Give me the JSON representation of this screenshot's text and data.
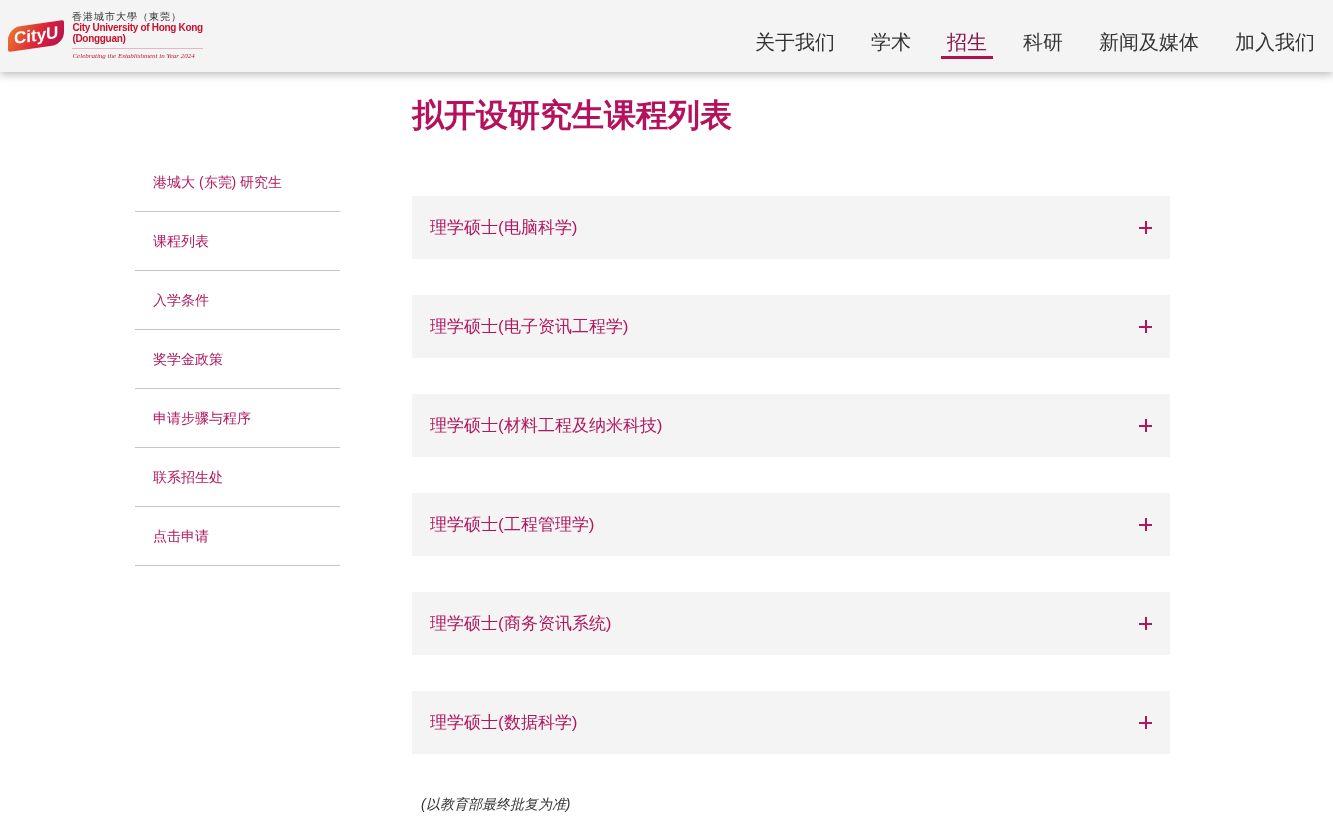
{
  "logo": {
    "mark": "CityU",
    "name_zh": "香港城市大學（東莞）",
    "name_en": "City University of Hong Kong",
    "name_sub": "(Dongguan)",
    "tagline": "Celebrating the Establishment in Year 2024"
  },
  "nav": [
    {
      "label": "关于我们",
      "selected": false
    },
    {
      "label": "学术",
      "selected": false
    },
    {
      "label": "招生",
      "selected": true
    },
    {
      "label": "科研",
      "selected": false
    },
    {
      "label": "新闻及媒体",
      "selected": false
    },
    {
      "label": "加入我们",
      "selected": false
    }
  ],
  "title": "拟开设研究生课程列表",
  "sidebar": {
    "items": [
      {
        "label": "港城大 (东莞) 研究生"
      },
      {
        "label": "课程列表"
      },
      {
        "label": "入学条件"
      },
      {
        "label": "奖学金政策"
      },
      {
        "label": "申请步骤与程序"
      },
      {
        "label": "联系招生处"
      },
      {
        "label": "点击申请"
      }
    ]
  },
  "programmes": [
    {
      "label": "理学硕士(电脑科学)",
      "expanded": false
    },
    {
      "label": "理学硕士(电子资讯工程学)",
      "expanded": false
    },
    {
      "label": "理学硕士(材料工程及纳米科技)",
      "expanded": false
    },
    {
      "label": "理学硕士(工程管理学)",
      "expanded": false
    },
    {
      "label": "理学硕士(商务资讯系统)",
      "expanded": false
    },
    {
      "label": "理学硕士(数据科学)",
      "expanded": false
    }
  ],
  "note": "(以教育部最终批复为准)"
}
